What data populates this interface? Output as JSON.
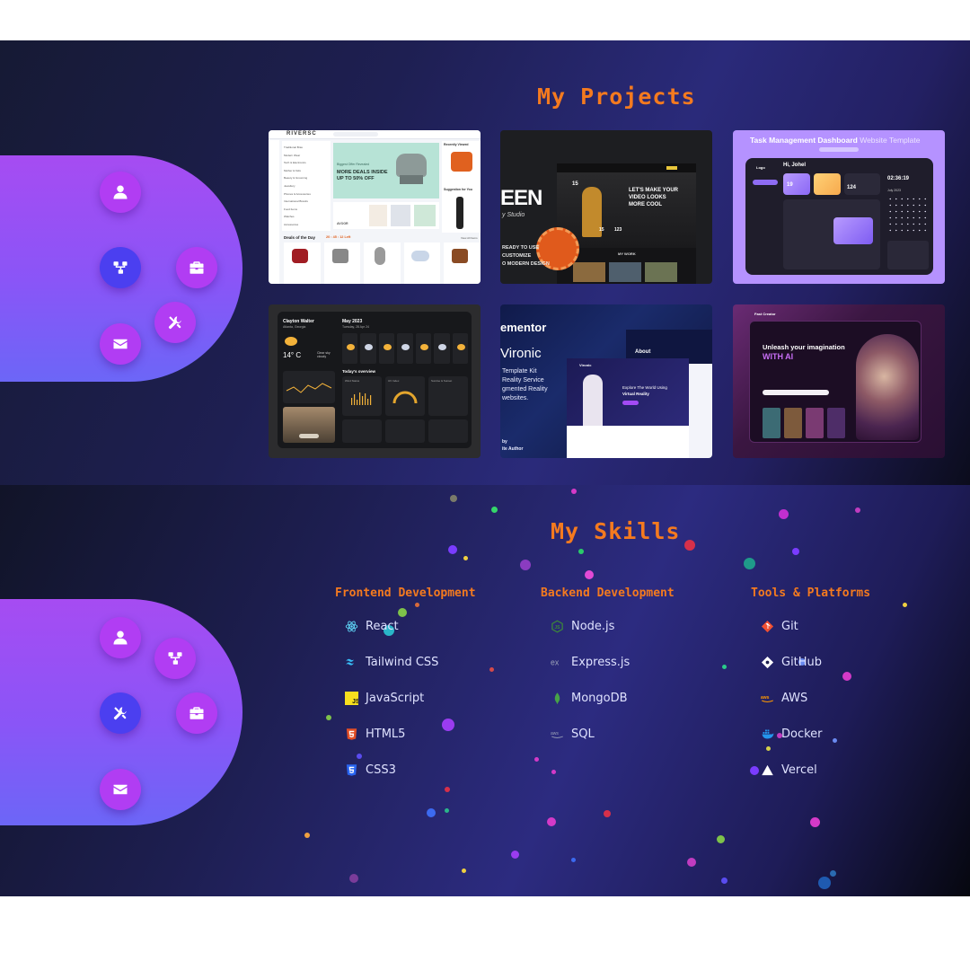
{
  "projects": {
    "title": "My Projects",
    "cards": [
      {
        "store": {
          "brand": "RIVERSC",
          "menu": [
            "Traditional Bras",
            "Modern Wear",
            "Tech & Electronics",
            "Mother & Kids",
            "Beauty & Grooming",
            "Jewellery",
            "Phones & Accessories",
            "International Brands",
            "Food Items",
            "Watches",
            "Accessories"
          ],
          "banner_kicker": "Biggest Offer Revealed",
          "banner_line1": "MORE DEALS INSIDE",
          "banner_line2": "UP TO 50% OFF",
          "side_title": "Recently Viewed",
          "suggest_title": "Suggestion for You",
          "deals_title": "Deals of the Day",
          "deals_timer": "20 : 45 : 12 Left",
          "view_more": "View All Items",
          "promo": "AVOOR"
        }
      },
      {
        "video": {
          "big_word": "EEN",
          "studio": "y Studio",
          "headline1": "LET'S MAKE YOUR",
          "headline2": "VIDEO LOOKS",
          "headline3": "MORE COOL",
          "stat1": "15",
          "stat2": "123",
          "work": "MY WORK",
          "left_line1": "READY TO USE",
          "left_line2": "CUSTOMIZE",
          "left_line3": "O MODERN DESIGN"
        }
      },
      {
        "task": {
          "caption_bold": "Task Management Dashboard",
          "caption_light": "Website Template",
          "greeting": "Hi, Johel",
          "logo": "Logo",
          "timer": "02:36:19",
          "stat_a": "19",
          "stat_b": "124",
          "month": "July 2023"
        }
      },
      {
        "weather": {
          "name": "Clayton Walter",
          "location": "Atlanta, Georgia",
          "month": "May 2023",
          "date": "Tuesday, 28 Apr 24",
          "temp": "14° C",
          "condition": "Clear sky cloudy",
          "overview": "Today's overview",
          "wind": "Wind Status",
          "uv": "UV Index",
          "sunrise": "Sunrise & Sunset"
        }
      },
      {
        "vr": {
          "brand_left": "ementor",
          "name_left": "Vironic",
          "line1": "Template Kit",
          "line2": "Reality Service",
          "line3": "gmented Reality",
          "line4": "websites.",
          "by1": "by",
          "by2": "ite Author",
          "site_logo": "Vironic",
          "hero1": "Explore The World Using",
          "hero2": "Virtual Reality",
          "about": "About"
        }
      },
      {
        "ai": {
          "logo": "Fast Creator",
          "headline1": "Unleash your imagination",
          "headline2": "WITH AI"
        }
      }
    ]
  },
  "sidebar": {
    "items": [
      {
        "icon": "user-icon"
      },
      {
        "icon": "project-network-icon"
      },
      {
        "icon": "briefcase-icon"
      },
      {
        "icon": "tools-icon"
      },
      {
        "icon": "mail-icon"
      }
    ]
  },
  "skills": {
    "title": "My Skills",
    "columns": [
      {
        "heading": "Frontend Development",
        "items": [
          {
            "label": "React",
            "icon": "react-icon",
            "color": "#61dafb"
          },
          {
            "label": "Tailwind CSS",
            "icon": "tailwind-icon",
            "color": "#38bdf8"
          },
          {
            "label": "JavaScript",
            "icon": "javascript-icon",
            "color": "#f7df1e"
          },
          {
            "label": "HTML5",
            "icon": "html5-icon",
            "color": "#e34f26"
          },
          {
            "label": "CSS3",
            "icon": "css3-icon",
            "color": "#2965f1"
          }
        ]
      },
      {
        "heading": "Backend Development",
        "items": [
          {
            "label": "Node.js",
            "icon": "nodejs-icon",
            "color": "#3c873a"
          },
          {
            "label": "Express.js",
            "icon": "express-icon",
            "color": "#9aa0b8"
          },
          {
            "label": "MongoDB",
            "icon": "mongodb-icon",
            "color": "#47a248"
          },
          {
            "label": "SQL",
            "icon": "sql-icon",
            "color": "#9aa0b8"
          }
        ]
      },
      {
        "heading": "Tools & Platforms",
        "items": [
          {
            "label": "Git",
            "icon": "git-icon",
            "color": "#f05032"
          },
          {
            "label": "GitHub",
            "icon": "github-icon",
            "color": "#ffffff"
          },
          {
            "label": "AWS",
            "icon": "aws-icon",
            "color": "#ff9900"
          },
          {
            "label": "Docker",
            "icon": "docker-icon",
            "color": "#2496ed"
          },
          {
            "label": "Vercel",
            "icon": "vercel-icon",
            "color": "#ffffff"
          }
        ]
      }
    ]
  },
  "colors": {
    "accent_orange": "#f47a1f",
    "nav_purple": "#b13df3",
    "nav_active": "#4b3ff0"
  }
}
